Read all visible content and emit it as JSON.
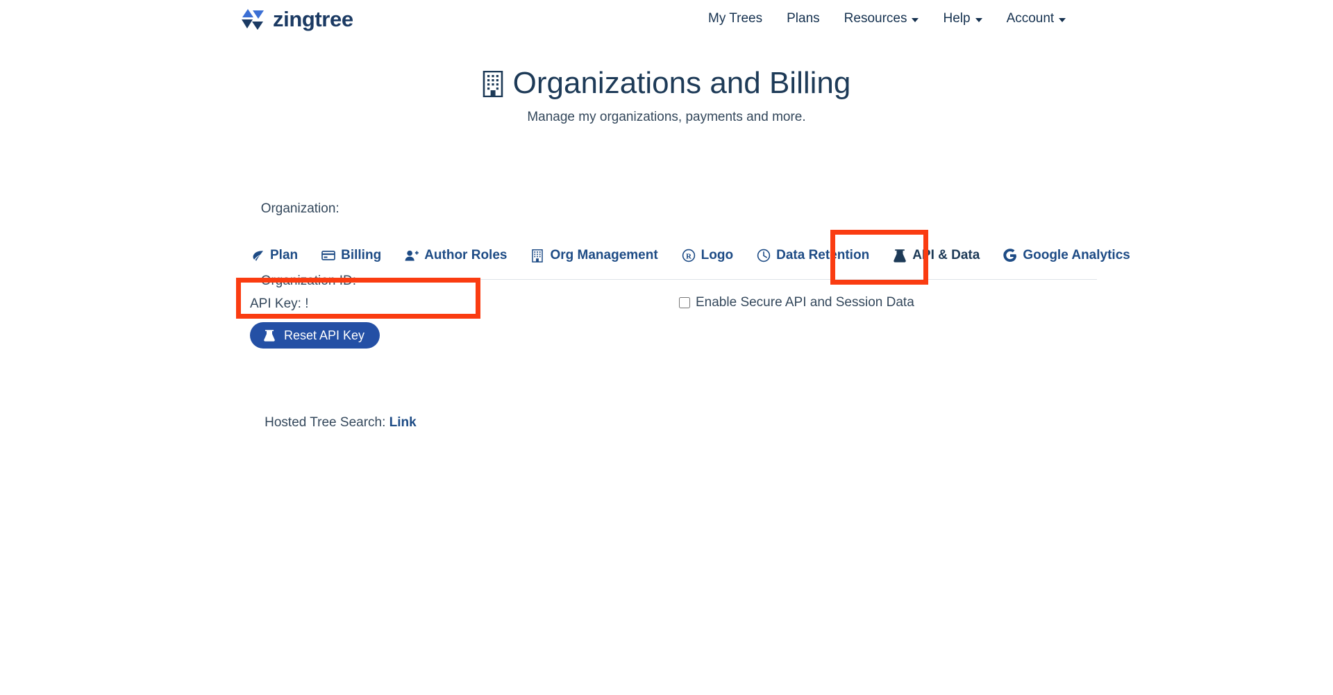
{
  "brand": {
    "name": "zingtree",
    "logo_icon": "zingtree-triangles-icon",
    "colors": {
      "light": "#3b6fd4",
      "dark": "#1b3a63"
    }
  },
  "nav": {
    "items": [
      {
        "label": "My Trees",
        "has_caret": false
      },
      {
        "label": "Plans",
        "has_caret": false
      },
      {
        "label": "Resources",
        "has_caret": true
      },
      {
        "label": "Help",
        "has_caret": true
      },
      {
        "label": "Account",
        "has_caret": true
      }
    ]
  },
  "header": {
    "icon": "building-icon",
    "title": "Organizations and Billing",
    "subtitle": "Manage my organizations, payments and more."
  },
  "org": {
    "organization_label": "Organization:",
    "organization_value": "",
    "organization_id_label": "Organization ID:",
    "organization_id_value": ""
  },
  "tabs": {
    "items": [
      {
        "label": "Plan",
        "icon": "leaf-icon",
        "active": false
      },
      {
        "label": "Billing",
        "icon": "credit-card-icon",
        "active": false
      },
      {
        "label": "Author Roles",
        "icon": "user-plus-icon",
        "active": false
      },
      {
        "label": "Org Management",
        "icon": "building-icon",
        "active": false
      },
      {
        "label": "Logo",
        "icon": "registered-trademark-icon",
        "active": false
      },
      {
        "label": "Data Retention",
        "icon": "clock-icon",
        "active": false
      },
      {
        "label": "API & Data",
        "icon": "flask-icon",
        "active": true
      },
      {
        "label": "Google Analytics",
        "icon": "google-g-icon",
        "active": false
      }
    ]
  },
  "panel": {
    "api_key_label": "API Key: !",
    "secure_checkbox_label": "Enable Secure API and Session Data",
    "secure_checkbox_checked": false,
    "reset_button_label": "Reset API Key",
    "reset_button_icon": "flask-icon",
    "hosted_search_label": "Hosted Tree Search: ",
    "hosted_search_link": "Link"
  },
  "annotations": {
    "highlight_color": "#fa3c11",
    "boxes": [
      {
        "name": "api-data-tab-highlight"
      },
      {
        "name": "api-key-highlight"
      }
    ]
  }
}
